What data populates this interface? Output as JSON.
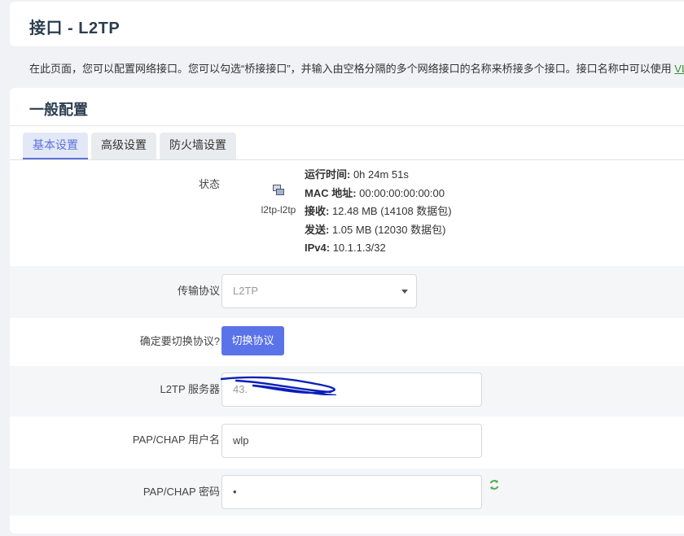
{
  "page": {
    "title": "接口 - L2TP",
    "description": "在此页面，您可以配置网络接口。您可以勾选“桥接接口”，并输入由空格分隔的多个网络接口的名称来桥接多个接口。接口名称中可以使用 ",
    "description_link": "VL"
  },
  "section": {
    "title": "一般配置",
    "tabs": [
      {
        "label": "基本设置",
        "active": true
      },
      {
        "label": "高级设置",
        "active": false
      },
      {
        "label": "防火墙设置",
        "active": false
      }
    ]
  },
  "status": {
    "label": "状态",
    "interface_name": "l2tp-l2tp",
    "icon": "network-interface-icon",
    "uptime_key": "运行时间:",
    "uptime_val": " 0h 24m 51s",
    "mac_key": "MAC 地址:",
    "mac_val": " 00:00:00:00:00:00",
    "rx_key": "接收:",
    "rx_val": " 12.48 MB (14108 数据包)",
    "tx_key": "发送:",
    "tx_val": " 1.05 MB (12030 数据包)",
    "ipv4_key": "IPv4:",
    "ipv4_val": " 10.1.1.3/32"
  },
  "protocol": {
    "label": "传输协议",
    "selected": "L2TP"
  },
  "switch": {
    "label": "确定要切换协议?",
    "button": "切换协议"
  },
  "server": {
    "label": "L2TP 服务器",
    "value": "43."
  },
  "username": {
    "label": "PAP/CHAP 用户名",
    "value": "wlp"
  },
  "password": {
    "label": "PAP/CHAP 密码",
    "value": "•",
    "reveal_icon": "refresh-reveal-icon"
  },
  "colors": {
    "accent": "#5b73e8",
    "link": "#3b8e2f",
    "redaction": "#0a1fb8"
  }
}
